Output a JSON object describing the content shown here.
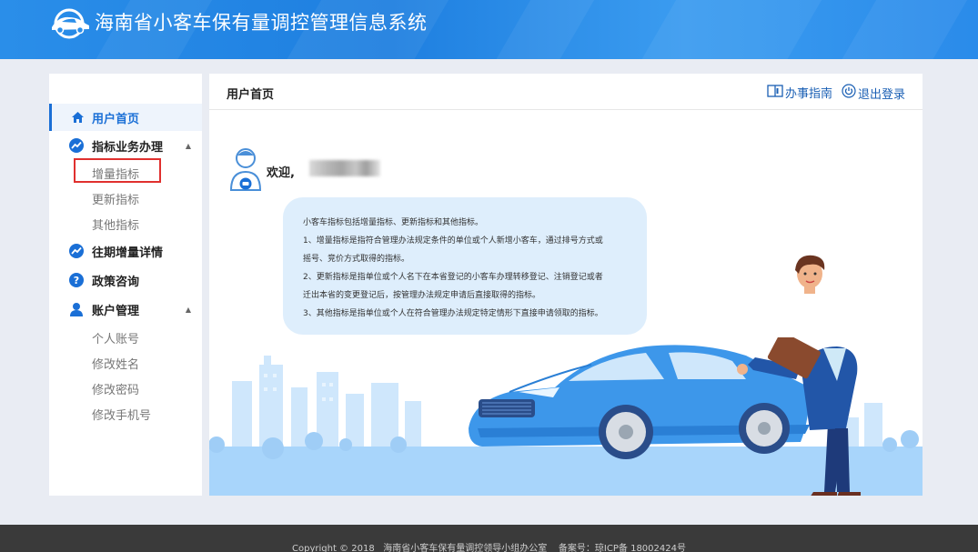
{
  "header": {
    "title": "海南省小客车保有量调控管理信息系统",
    "logo_icon": "car-circle-logo-icon"
  },
  "sidebar": {
    "items": [
      {
        "label": "用户首页",
        "icon": "home-icon",
        "active": true
      },
      {
        "label": "指标业务办理",
        "icon": "trend-icon",
        "expanded": true,
        "children": [
          "增量指标",
          "更新指标",
          "其他指标"
        ]
      },
      {
        "label": "往期增量详情",
        "icon": "trend-icon"
      },
      {
        "label": "政策咨询",
        "icon": "question-icon"
      },
      {
        "label": "账户管理",
        "icon": "user-icon",
        "expanded": true,
        "children": [
          "个人账号",
          "修改姓名",
          "修改密码",
          "修改手机号"
        ]
      }
    ],
    "highlighted_item": "增量指标"
  },
  "main": {
    "title": "用户首页",
    "links": [
      {
        "label": "办事指南",
        "icon": "book-icon"
      },
      {
        "label": "退出登录",
        "icon": "power-icon"
      }
    ],
    "welcome": "欢迎,",
    "info_lines": [
      "小客车指标包括增量指标、更新指标和其他指标。",
      "1、增量指标是指符合管理办法规定条件的单位或个人新增小客车，通过排号方式或",
      "摇号、竞价方式取得的指标。",
      "2、更新指标是指单位或个人名下在本省登记的小客车办理转移登记、注销登记或者",
      "迁出本省的变更登记后，按管理办法规定申请后直接取得的指标。",
      "3、其他指标是指单位或个人在符合管理办法规定特定情形下直接申请领取的指标。"
    ]
  },
  "footer": {
    "text": "Copyright © 2018   海南省小客车保有量调控领导小组办公室    备案号：琼ICP备 18002424号"
  },
  "colors": {
    "header_blue": "#2a8ee9",
    "accent": "#1a6fd6",
    "highlight_red": "#e0302e",
    "footer_bg": "#3a3a3a"
  }
}
